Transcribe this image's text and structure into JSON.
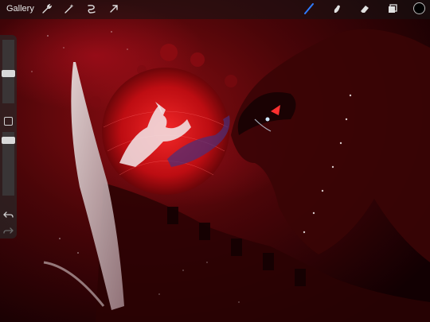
{
  "app": {
    "gallery_label": "Gallery"
  },
  "toolbar": {
    "left_tools": [
      "wrench-icon",
      "magic-wand-icon",
      "selection-icon",
      "transform-arrow-icon"
    ],
    "right_tools": [
      "brush-icon",
      "smudge-icon",
      "eraser-icon",
      "layers-icon"
    ],
    "active_tool": "brush-icon",
    "active_color": "#000000",
    "accent": "#2f7bff"
  },
  "sidebar": {
    "brush_size_slider": "slider",
    "opacity_slider": "slider",
    "modify_button": "square-button",
    "undo": "undo-icon",
    "redo": "redo-icon"
  }
}
